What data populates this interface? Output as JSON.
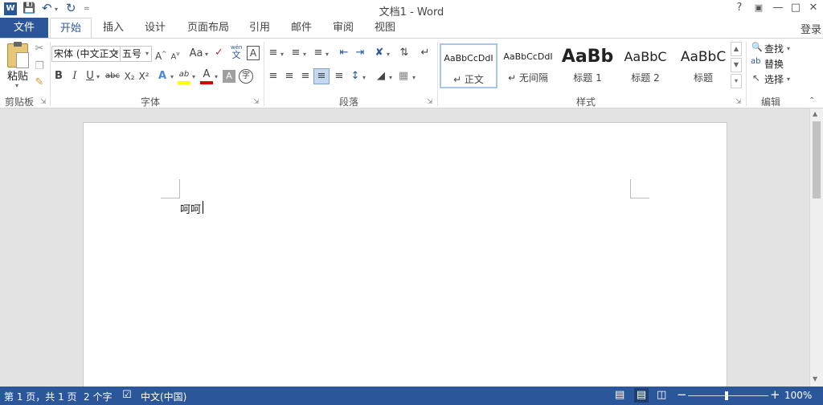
{
  "window": {
    "title": "文档1 - Word",
    "help": "?",
    "signin": "登录"
  },
  "tabs": {
    "file": "文件",
    "home": "开始",
    "insert": "插入",
    "design": "设计",
    "layout": "页面布局",
    "references": "引用",
    "mailings": "邮件",
    "review": "审阅",
    "view": "视图"
  },
  "clipboard": {
    "paste": "粘贴",
    "group": "剪贴板"
  },
  "font": {
    "name": "宋体 (中文正文",
    "size": "五号",
    "group": "字体",
    "case": "Aa",
    "phonetic_top": "wén",
    "phonetic_bottom": "文",
    "border_char": "A",
    "bold": "B",
    "italic": "I",
    "underline": "U",
    "strike": "abc",
    "sub": "X₂",
    "sup": "X²",
    "effects": "A",
    "highlight": "ab",
    "color": "A",
    "shade": "A",
    "enclose": "字",
    "highlight_color": "#ffff00",
    "font_color": "#e00000"
  },
  "paragraph": {
    "group": "段落"
  },
  "styles": {
    "group": "样式",
    "items": [
      {
        "preview": "AaBbCcDdI",
        "name": "↵ 正文"
      },
      {
        "preview": "AaBbCcDdI",
        "name": "↵ 无间隔"
      },
      {
        "preview": "AaBb",
        "name": "标题 1"
      },
      {
        "preview": "AaBbC",
        "name": "标题 2"
      },
      {
        "preview": "AaBbC",
        "name": "标题"
      }
    ]
  },
  "editing": {
    "find": "查找",
    "replace": "替换",
    "select": "选择",
    "group": "编辑"
  },
  "document": {
    "text": "呵呵"
  },
  "status": {
    "page": "第 1 页，共 1 页",
    "words": "2 个字",
    "lang": "中文(中国)",
    "zoom": "100%"
  },
  "colors": {
    "accent": "#2b579a",
    "selected_style_border": "#a9c6ea"
  }
}
